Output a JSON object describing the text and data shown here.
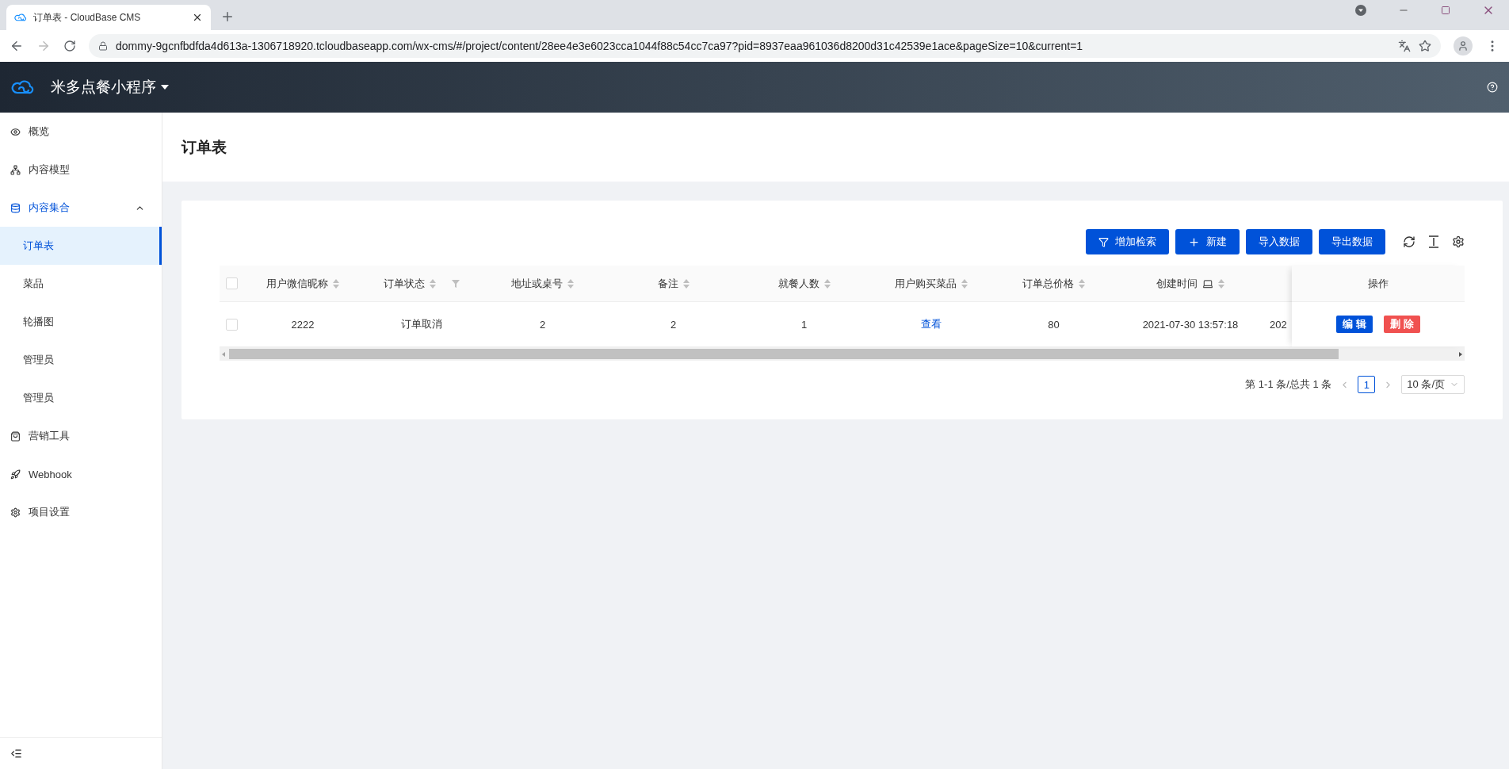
{
  "browser": {
    "tab_title": "订单表 - CloudBase CMS",
    "url": "dommy-9gcnfbdfda4d613a-1306718920.tcloudbaseapp.com/wx-cms/#/project/content/28ee4e3e6023cca1044f88c54cc7ca97?pid=8937eaa961036d8200d31c42539e1ace&pageSize=10&current=1"
  },
  "header": {
    "project": "米多点餐小程序"
  },
  "sidebar": {
    "items": [
      {
        "label": "概览",
        "selected": false
      },
      {
        "label": "内容模型",
        "selected": false
      },
      {
        "label": "内容集合",
        "selected": false,
        "expanded": true,
        "children": [
          {
            "label": "订单表",
            "selected": true
          },
          {
            "label": "菜品",
            "selected": false
          },
          {
            "label": "轮播图",
            "selected": false
          },
          {
            "label": "管理员",
            "selected": false
          },
          {
            "label": "管理员",
            "selected": false
          }
        ]
      },
      {
        "label": "营销工具",
        "selected": false
      },
      {
        "label": "Webhook",
        "selected": false
      },
      {
        "label": "项目设置",
        "selected": false
      }
    ]
  },
  "page": {
    "title": "订单表"
  },
  "toolbar": {
    "buttons": [
      {
        "label": "增加检索"
      },
      {
        "label": "新建"
      },
      {
        "label": "导入数据"
      },
      {
        "label": "导出数据"
      }
    ]
  },
  "table": {
    "header_checked": false,
    "columns": [
      {
        "label": "用户微信昵称",
        "kind": "sort"
      },
      {
        "label": "订单状态",
        "kind": "filter"
      },
      {
        "label": "地址或桌号",
        "kind": "sort"
      },
      {
        "label": "备注",
        "kind": "sort"
      },
      {
        "label": "就餐人数",
        "kind": "sort"
      },
      {
        "label": "用户购买菜品",
        "kind": "sort"
      },
      {
        "label": "订单总价格",
        "kind": "sort"
      },
      {
        "label": "创建时间",
        "kind": "datetime"
      },
      {
        "kind": "cut"
      }
    ],
    "action_column": "操作",
    "rows": [
      {
        "checked": false,
        "cells": [
          {
            "text": "2222",
            "kind": "text"
          },
          {
            "text": "订单取消",
            "kind": "text"
          },
          {
            "text": "2",
            "kind": "text"
          },
          {
            "text": "2",
            "kind": "text"
          },
          {
            "text": "1",
            "kind": "text"
          },
          {
            "text": "查看",
            "kind": "link"
          },
          {
            "text": "80",
            "kind": "text"
          },
          {
            "text": "2021-07-30 13:57:18",
            "kind": "text"
          },
          {
            "text": "202",
            "kind": "text"
          }
        ],
        "actions": [
          {
            "label": "编 辑",
            "kind": "primary"
          },
          {
            "label": "删 除",
            "kind": "danger"
          }
        ]
      }
    ]
  },
  "pagination": {
    "summary": "第 1-1 条/总共 1 条",
    "pages": [
      {
        "label": "1",
        "selected": true
      }
    ],
    "page_size": "10 条/页"
  }
}
